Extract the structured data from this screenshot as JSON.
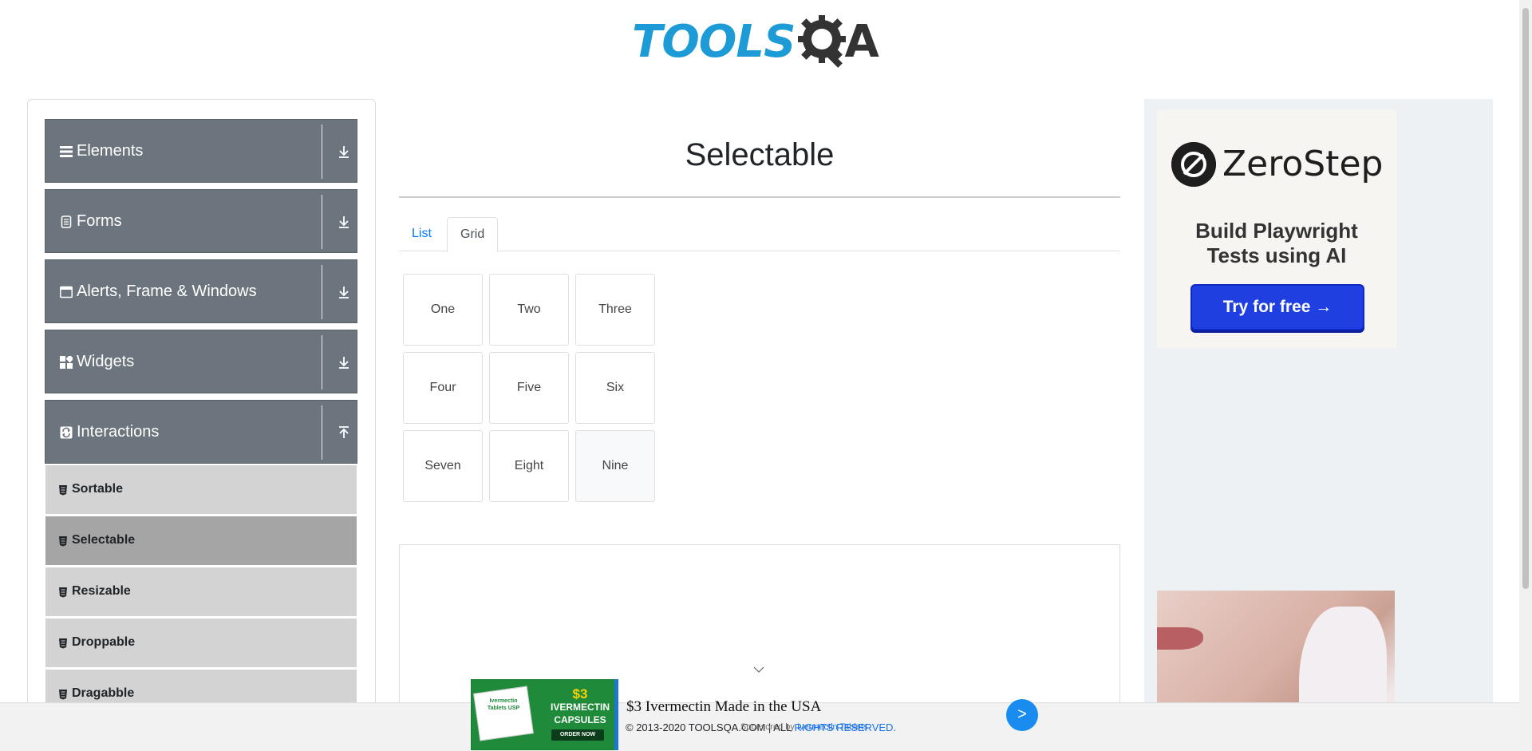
{
  "logo": {
    "part1": "TOOLS",
    "part2": "A"
  },
  "sidebar": {
    "groups": [
      {
        "label": "Elements",
        "icon": "menu-icon",
        "arrow": "download-icon"
      },
      {
        "label": "Forms",
        "icon": "document-icon",
        "arrow": "download-icon"
      },
      {
        "label": "Alerts, Frame & Windows",
        "icon": "window-icon",
        "arrow": "download-icon"
      },
      {
        "label": "Widgets",
        "icon": "widgets-icon",
        "arrow": "download-icon"
      },
      {
        "label": "Interactions",
        "icon": "interactions-icon",
        "arrow": "upload-icon"
      }
    ],
    "items": [
      {
        "label": "Sortable"
      },
      {
        "label": "Selectable",
        "active": true
      },
      {
        "label": "Resizable"
      },
      {
        "label": "Droppable"
      },
      {
        "label": "Dragabble"
      }
    ]
  },
  "main": {
    "title": "Selectable",
    "tabs": [
      {
        "label": "List"
      },
      {
        "label": "Grid",
        "active": true
      }
    ],
    "grid": [
      "One",
      "Two",
      "Three",
      "Four",
      "Five",
      "Six",
      "Seven",
      "Eight",
      "Nine"
    ]
  },
  "right_ad": {
    "brand": "ZeroStep",
    "tagline_line1": "Build Playwright",
    "tagline_line2": "Tests using AI",
    "cta": "Try for free →"
  },
  "footer": {
    "copyright_prefix": "© 2013-2020 TOOLSQA.COM | ALL ",
    "copyright_suffix": "RIGHTS RESERVED."
  },
  "bottom_ad": {
    "title": "$3 Ivermectin Made in the USA",
    "sponsor_prefix": "Sponsored by ",
    "sponsor": "Ivermectin Tablets",
    "box_label": "Ivermectin Tablets USP",
    "price_line1": "$3",
    "price_line2": "IVERMECTIN",
    "price_line3": "CAPSULES",
    "order": "ORDER NOW",
    "go": ">"
  },
  "colors": {
    "brand_blue": "#1c9bd6",
    "sidebar_group": "#6c757d",
    "sidebar_item": "#d3d3d3",
    "sidebar_item_active": "#a5a5a5",
    "link_blue": "#007bff",
    "cta_blue": "#1f3fe0"
  }
}
